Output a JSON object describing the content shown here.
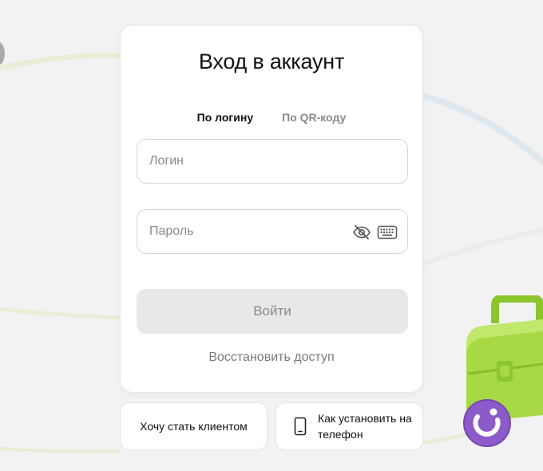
{
  "title": "Вход в аккаунт",
  "tabs": [
    {
      "label": "По логину",
      "active": true
    },
    {
      "label": "По QR-коду",
      "active": false
    }
  ],
  "login_field": {
    "value": "",
    "placeholder": "Логин"
  },
  "password_field": {
    "value": "",
    "placeholder": "Пароль"
  },
  "submit_label": "Войти",
  "restore_label": "Восстановить доступ",
  "become_client_label": "Хочу стать клиентом",
  "install_label": "Как установить на телефон",
  "icons": {
    "password_visibility": "eye-off-icon",
    "virtual_keyboard": "keyboard-icon",
    "phone": "phone-icon"
  },
  "colors": {
    "background": "#f2f2f2",
    "card": "#ffffff",
    "disabled_button": "#e8e8e8",
    "muted_text": "#8a8a8a",
    "briefcase_green": "#9fd43c",
    "badge_purple": "#8b5cc9"
  }
}
